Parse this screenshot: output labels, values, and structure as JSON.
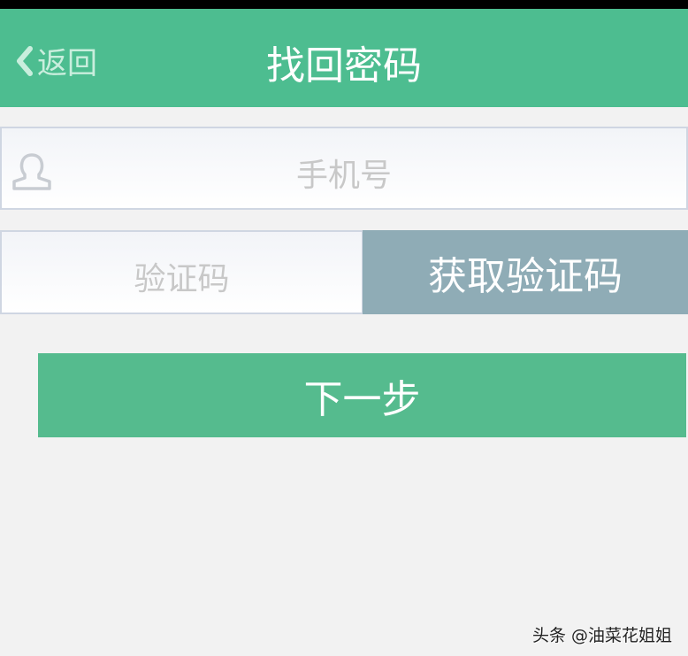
{
  "header": {
    "back_label": "返回",
    "title": "找回密码"
  },
  "form": {
    "phone_placeholder": "手机号",
    "code_placeholder": "验证码",
    "get_code_label": "获取验证码",
    "next_label": "下一步"
  },
  "watermark": "头条 @油菜花姐姐",
  "colors": {
    "header": "#4dbd90",
    "get_code": "#8facb6",
    "next": "#55bb8e"
  }
}
